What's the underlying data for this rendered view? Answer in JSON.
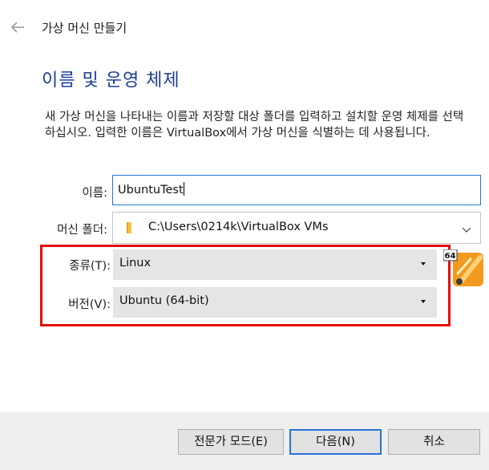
{
  "header": {
    "title": "가상 머신 만들기"
  },
  "page": {
    "title": "이름 및 운영 체제",
    "description": "새 가상 머신을 나타내는 이름과 저장할 대상 폴더를 입력하고 설치할 운영 체제를 선택하십시오. 입력한 이름은 VirtualBox에서 가상 머신을 식별하는 데 사용됩니다."
  },
  "form": {
    "name_label": "이름:",
    "name_value": "UbuntuTest",
    "folder_label": "머신 폴더:",
    "folder_value": "C:\\Users\\0214k\\VirtualBox VMs",
    "type_label": "종류(T):",
    "type_value": "Linux",
    "version_label": "버전(V):",
    "version_value": "Ubuntu (64-bit)"
  },
  "os_icon": {
    "badge": "64",
    "name": "ubuntu-64-os-icon"
  },
  "buttons": {
    "expert": "전문가 모드(E)",
    "next": "다음(N)",
    "cancel": "취소"
  },
  "colors": {
    "title": "#1c3f94",
    "highlight": "#e30d0d",
    "focus": "#1e73d8"
  }
}
